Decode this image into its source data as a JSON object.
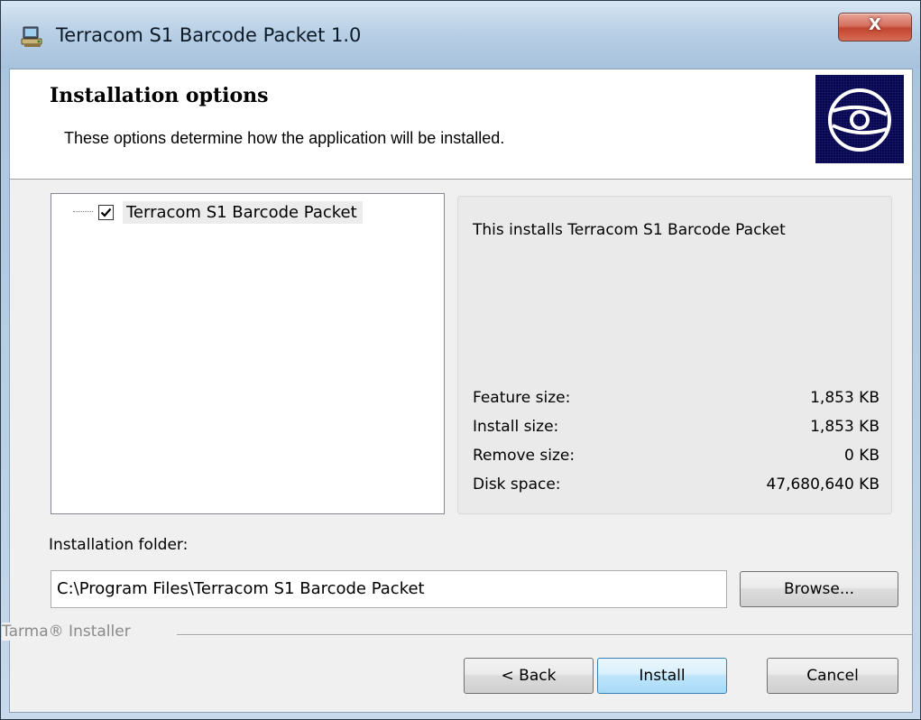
{
  "window": {
    "title": "Terracom S1 Barcode Packet 1.0",
    "close_label": "X"
  },
  "header": {
    "title": "Installation options",
    "subtitle": "These options determine how the application will be installed."
  },
  "tree": {
    "items": [
      {
        "label": "Terracom S1 Barcode Packet",
        "checked": true
      }
    ]
  },
  "info": {
    "description": "This installs Terracom S1 Barcode Packet",
    "rows": [
      {
        "label": "Feature size:",
        "value": "1,853 KB"
      },
      {
        "label": "Install size:",
        "value": "1,853 KB"
      },
      {
        "label": "Remove size:",
        "value": "0 KB"
      },
      {
        "label": "Disk space:",
        "value": "47,680,640 KB"
      }
    ]
  },
  "folder": {
    "label": "Installation folder:",
    "value": "C:\\Program Files\\Terracom S1 Barcode Packet",
    "browse_label": "Browse..."
  },
  "footer": {
    "brand": "Tarma® Installer",
    "back_label": "< Back",
    "install_label": "Install",
    "cancel_label": "Cancel"
  },
  "colors": {
    "logo_bg": "#06064a",
    "focus_border": "#3c7fb1",
    "close_red": "#c24530"
  },
  "icons": {
    "app": "installer-computer-icon",
    "logo": "disc-icon",
    "checkbox": "checkmark-icon"
  }
}
